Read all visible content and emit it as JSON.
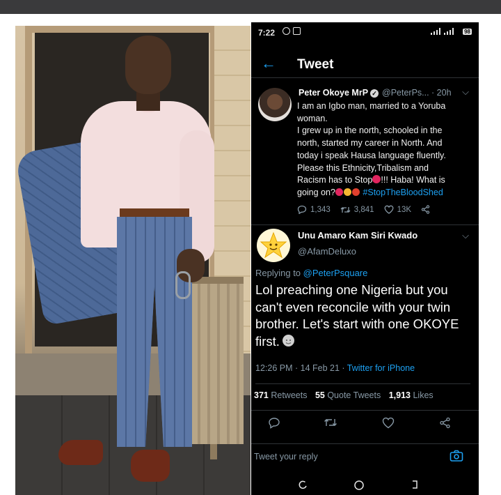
{
  "status_bar": {
    "time": "7:22",
    "battery": "98"
  },
  "header": {
    "title": "Tweet"
  },
  "quoted_tweet": {
    "author_name": "Peter Okoye MrP",
    "handle_time": "@PeterPs... · 20h",
    "lines": [
      "I am an Igbo man, married to a Yoruba",
      "woman.",
      "I grew up in the north, schooled in the",
      "north, started my career in North. And",
      "today i speak Hausa language fluently.",
      "Please this Ethnicity,Tribalism and",
      "Racism has to Stop",
      "!!! Haba! What is",
      "going on?",
      "#StopTheBloodShed"
    ],
    "replies": "1,343",
    "retweets": "3,841",
    "likes": "13K"
  },
  "reply_tweet": {
    "author_name": "Unu Amaro Kam Siri Kwado",
    "handle": "@AfamDeluxo",
    "replying_prefix": "Replying to",
    "replying_to": "@PeterPsquare",
    "text": "Lol preaching one Nigeria but you can't even reconcile with your twin brother. Let's start with one OKOYE first.",
    "timestamp": "12:26 PM · 14 Feb 21 ·",
    "source": "Twitter for iPhone"
  },
  "stats": {
    "retweets_count": "371",
    "retweets_label": "Retweets",
    "quotes_count": "55",
    "quotes_label": "Quote Tweets",
    "likes_count": "1,913",
    "likes_label": "Likes"
  },
  "composer": {
    "placeholder": "Tweet your reply"
  },
  "colors": {
    "accent": "#1da1f2",
    "background": "#000000",
    "secondary_text": "#8899a6"
  },
  "icons": [
    "back-arrow-icon",
    "verified-badge-icon",
    "reply-icon",
    "retweet-icon",
    "like-icon",
    "share-icon",
    "camera-icon",
    "recents-nav-icon",
    "home-nav-icon",
    "back-nav-icon"
  ]
}
